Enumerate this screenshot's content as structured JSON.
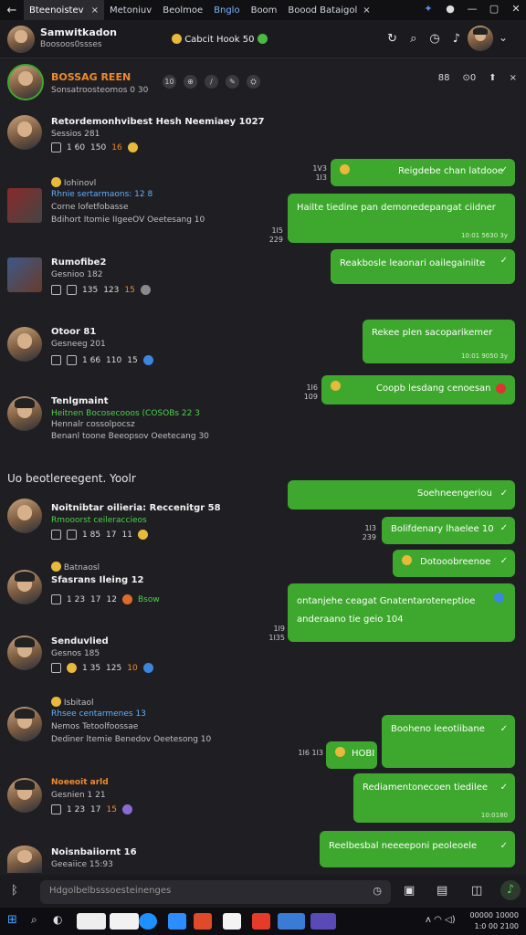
{
  "tabs": {
    "back": "←",
    "active_tab": "Bteenoistev",
    "close": "×",
    "others": [
      "Metoniuv",
      "Beolmoe",
      "Bnglo",
      "Boom",
      "Boood Bataigol"
    ]
  },
  "window_controls": [
    "▢",
    "✕"
  ],
  "topbar": {
    "title": "Samwitkadon",
    "subtitle": "Boosoos0ssses",
    "center": "Cabcit Hook 50",
    "icons": [
      "refresh-icon",
      "search-icon",
      "clock-icon",
      "mic-icon"
    ]
  },
  "chat_header": {
    "name": "BOSSAG REEN",
    "subtitle": "Sonsatroosteomos 0 30",
    "tools": [
      "10",
      "⊕",
      "/",
      "✎",
      "⛭"
    ],
    "right": [
      "88",
      "⊙0",
      "⬆",
      "×"
    ]
  },
  "messages_in": [
    {
      "name": "Retordemonhvibest Hesh Neemiaey 1027",
      "line1": "Sessios 281",
      "stats": [
        "1 60",
        "150",
        "16",
        "☺"
      ]
    },
    {
      "pre": "Iohinovl",
      "name": "Rhnie sertarmaons: 12 8",
      "line1": "Corne lofetfobasse",
      "line2": "Bdihort Itomie IIgeeOV Oeetesang 10"
    },
    {
      "name": "Rumofibe2",
      "line1": "Gesnioo 182",
      "stats": [
        "135",
        "123",
        "15",
        "⛭"
      ]
    },
    {
      "name": "Otoor 81",
      "line1": "Gesneeg 201",
      "stats": [
        "1 66",
        "110",
        "15",
        "⛭"
      ]
    },
    {
      "name": "Tenlgmaint",
      "line1": "Heitnen Bocosecooos (COSOBs 22 3",
      "line2": "Hennalr cossolpocsz",
      "line3": "Benanl toone Beeopsov Oeetecang 30"
    },
    {
      "name": "Noitnibtar oilieria: Reccenitgr 58",
      "line1": "Rmooorst ceileraccieos",
      "stats": [
        "1 85",
        "17",
        "11",
        "☺"
      ]
    },
    {
      "pre": "Batnaosl",
      "name": "Sfasrans Ileing 12",
      "stats": [
        "1 23",
        "17",
        "12",
        "☺",
        "Bsow"
      ]
    },
    {
      "name": "Senduvlied",
      "line1": "Gesnos 185",
      "stats": [
        "1 35",
        "125",
        "10",
        "⛭"
      ]
    },
    {
      "pre": "Isbitaol",
      "name": "Rhsee centarmenes 13",
      "line1": "Nemos Tetoolfoossae",
      "line2": "Dediner ltemie Benedov Oeetesong 10"
    },
    {
      "name": "Noeeoit arld",
      "line1": "Gesnien 1 21",
      "stats": [
        "1 23",
        "17",
        "15",
        "⛭"
      ]
    },
    {
      "name": "Noisnbaiiornt 16",
      "line1": "Geeaiice 15:93"
    }
  ],
  "messages_out": [
    {
      "text": "Reigdebe chan latdooe",
      "time": "1V3 1I3"
    },
    {
      "text": "Hailte tiedine pan demonedepangat ciidner",
      "meta": "10:01 5630 3y",
      "time": "1I5 229"
    },
    {
      "text": "Reakbosle leaonari oailegainiite",
      "time": ""
    },
    {
      "text": "Rekee plen sacoparikemer",
      "meta": "10:01 9050 3y",
      "time": ""
    },
    {
      "text": "Coopb lesdang cenoesan",
      "time": "1I6 109"
    },
    {
      "text": "Soehneengeriou",
      "time": ""
    },
    {
      "text": "Bolifdenary lhaelee 10",
      "time": "1I3 239"
    },
    {
      "text": "Dotooobreenoe",
      "time": ""
    },
    {
      "text": "ontanjehe ceagat Gnatentaroteneptioe anderaano tie geio 104",
      "time": "1I9 1I35"
    },
    {
      "text": "Booheno leeotiibane",
      "time": ""
    },
    {
      "text": "HOBI",
      "time": "1I6 1I3"
    },
    {
      "text": "Rediamentonecoen tiedilee",
      "meta": "10:0180",
      "time": ""
    },
    {
      "text": "Reelbesbal neeeeponi peoleoele",
      "time": ""
    }
  ],
  "divider": "Uo beotlereegent. Yoolr",
  "composer": {
    "placeholder": "Hdgolbelbsssoesteinenges",
    "left_icon": "bluetooth-icon",
    "right_icons": [
      "clock-icon",
      "image-icon",
      "gif-icon",
      "sticker-icon",
      "mic-icon"
    ]
  },
  "taskbar": {
    "clock_line1": "00000 10000",
    "clock_line2": "1:0 00 2100"
  },
  "colors": {
    "bubble": "#3ea82e",
    "accent_orange": "#f08a2a",
    "accent_blue": "#5fb0ff",
    "background": "#1f1f23"
  }
}
